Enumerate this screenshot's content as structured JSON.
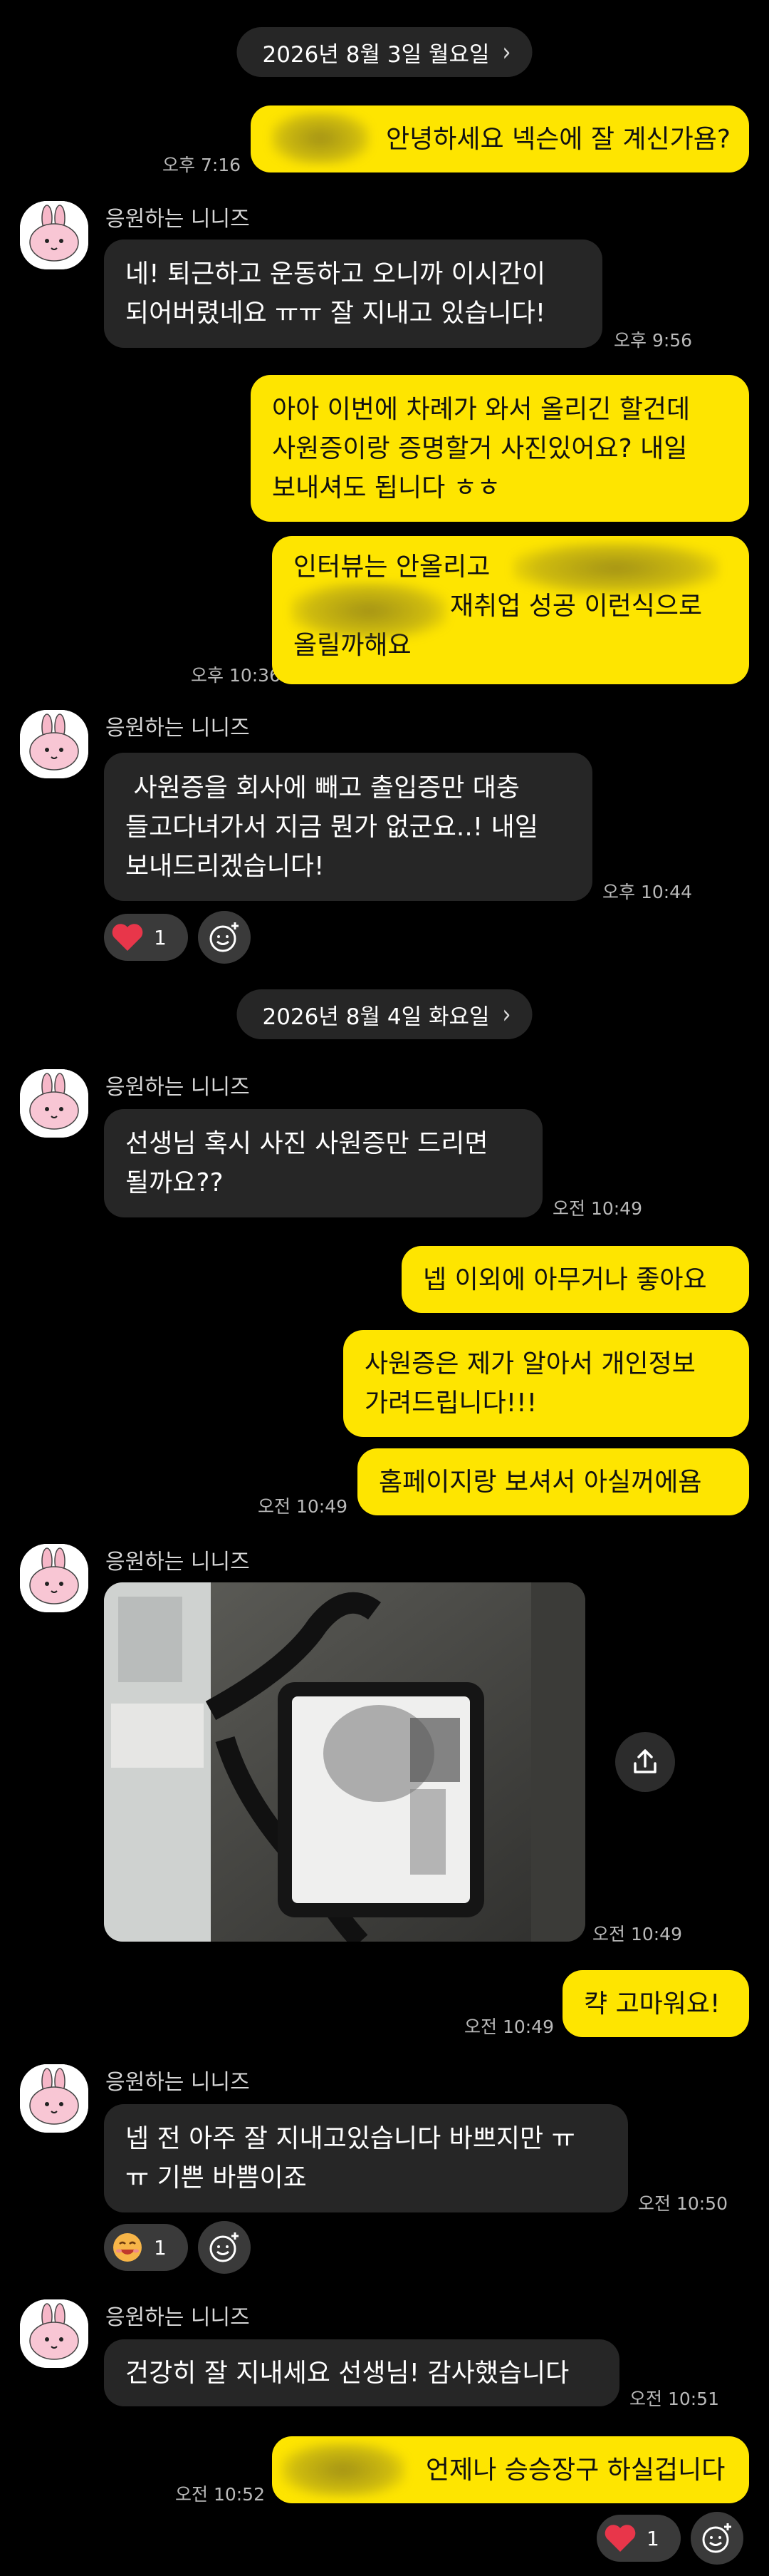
{
  "dates": [
    "2026년 8월 3일 월요일",
    "2026년 8월 4일 화요일"
  ],
  "contact_name": "응원하는 니니즈",
  "messages": {
    "m1": {
      "text": "안녕하세요 넥슨에 잘 계신가욤?",
      "time": "오후 7:16"
    },
    "m2": {
      "text": "네! 퇴근하고 운동하고 오니까 이시간이\n되어버렸네요 ㅠㅠ 잘 지내고 있습니다!",
      "time": "오후 9:56"
    },
    "m3": {
      "text": "아아 이번에 차례가 와서 올리긴 할건데\n사원증이랑 증명할거 사진있어요? 내일\n보내셔도 됩니다 ㅎㅎ"
    },
    "m4": {
      "text_line1": "인터뷰는 안올리고",
      "text_line2": "재취업 성공 이런식으로",
      "text_line3": "올릴까해요",
      "time": "오후 10:36"
    },
    "m5": {
      "text": " 사원증을 회사에 빼고 출입증만 대충\n들고다녀가서 지금 뭔가 없군요..! 내일\n보내드리겠습니다!",
      "time": "오후 10:44"
    },
    "m6": {
      "text": "선생님 혹시 사진 사원증만 드리면\n될까요??",
      "time": "오전 10:49"
    },
    "m7": {
      "text": "넵 이외에 아무거나 좋아요"
    },
    "m8": {
      "text": "사원증은 제가 알아서 개인정보\n가려드립니다!!!"
    },
    "m9": {
      "text": "홈페이지랑 보셔서 아실꺼에욤",
      "time": "오전 10:49"
    },
    "m10": {
      "time": "오전 10:49"
    },
    "m11": {
      "text": "캭 고마워요!",
      "time": "오전 10:49"
    },
    "m12": {
      "text": "넵 전 아주 잘 지내고있습니다 바쁘지만 ㅠ\nㅠ 기쁜 바쁨이죠",
      "time": "오전 10:50"
    },
    "m13": {
      "text": "건강히 잘 지내세요 선생님! 감사했습니다",
      "time": "오전 10:51"
    },
    "m14": {
      "text": "언제나 승승장구 하실겁니다",
      "time": "오전 10:52"
    }
  },
  "reactions": {
    "r1": {
      "emoji": "heart",
      "count": "1"
    },
    "r2": {
      "emoji": "grin-emoji",
      "count": "1"
    },
    "r3": {
      "emoji": "heart",
      "count": "1"
    }
  },
  "colors": {
    "my_bubble": "#FEE500",
    "their_bubble": "#262626",
    "background": "#000000"
  }
}
